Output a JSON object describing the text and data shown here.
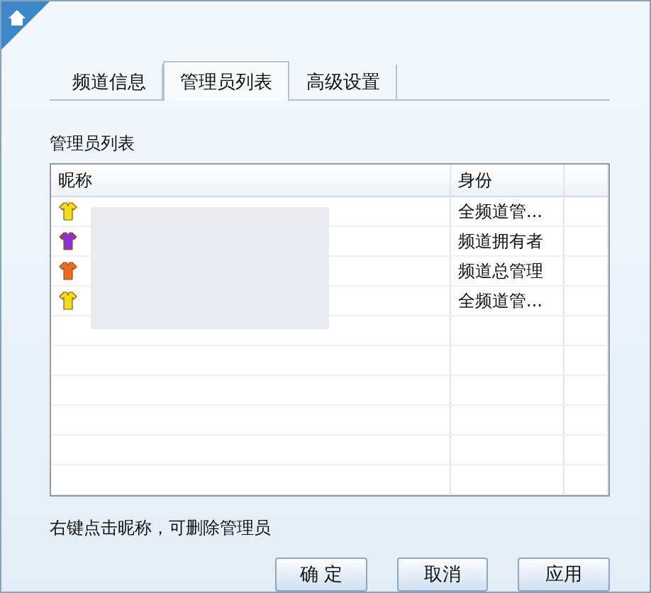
{
  "tabs": [
    {
      "label": "频道信息",
      "selected": false
    },
    {
      "label": "管理员列表",
      "selected": true
    },
    {
      "label": "高级设置",
      "selected": false
    }
  ],
  "section_label": "管理员列表",
  "table": {
    "columns": [
      "昵称",
      "身份"
    ],
    "rows": [
      {
        "color": "#f2dc1c",
        "role": "全频道管..."
      },
      {
        "color": "#8b2fd6",
        "role": "频道拥有者"
      },
      {
        "color": "#ee6a24",
        "role": "频道总管理"
      },
      {
        "color": "#f2dc1c",
        "role": "全频道管..."
      }
    ]
  },
  "hint": "右键点击昵称，可删除管理员",
  "buttons": [
    "确 定",
    "取消",
    "应用"
  ]
}
